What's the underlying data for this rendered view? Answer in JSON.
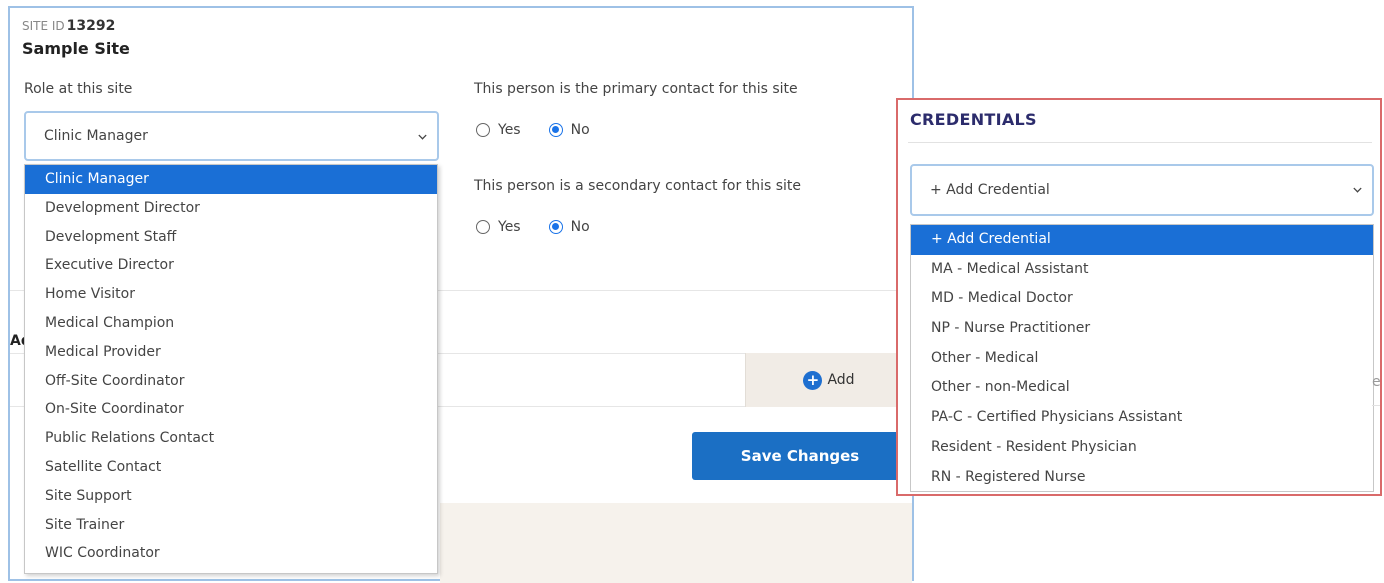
{
  "site": {
    "id_label": "SITE ID",
    "id_value": "13292",
    "name": "Sample Site",
    "role_label": "Role at this site",
    "role_selected": "Clinic Manager",
    "primary_question": "This person is the primary contact for this site",
    "secondary_question": "This person is a secondary contact for this site",
    "yes_label": "Yes",
    "no_label": "No",
    "primary_value": "No",
    "secondary_value": "No",
    "add_label": "Add",
    "section_fragment": "Ad",
    "save_label": "Save Changes"
  },
  "role_options": [
    "Clinic Manager",
    "Development Director",
    "Development Staff",
    "Executive Director",
    "Home Visitor",
    "Medical Champion",
    "Medical Provider",
    "Off-Site Coordinator",
    "On-Site Coordinator",
    "Public Relations Contact",
    "Satellite Contact",
    "Site Support",
    "Site Trainer",
    "WIC Coordinator"
  ],
  "credentials": {
    "title": "CREDENTIALS",
    "selected": "+ Add Credential",
    "right_fragment": "e",
    "options": [
      "+ Add Credential",
      "MA - Medical Assistant",
      "MD - Medical Doctor",
      "NP - Nurse Practitioner",
      "Other - Medical",
      "Other - non-Medical",
      "PA-C - Certified Physicians Assistant",
      "Resident - Resident Physician",
      "RN - Registered Nurse"
    ]
  },
  "icons": {
    "add": "plus-circle-icon",
    "dropdown": "chevron-down-icon"
  },
  "colors": {
    "accent": "#1a6fd6",
    "save_button": "#1b6fc4",
    "credentials_border": "#d96a6a",
    "select_border": "#a9c9ea"
  }
}
